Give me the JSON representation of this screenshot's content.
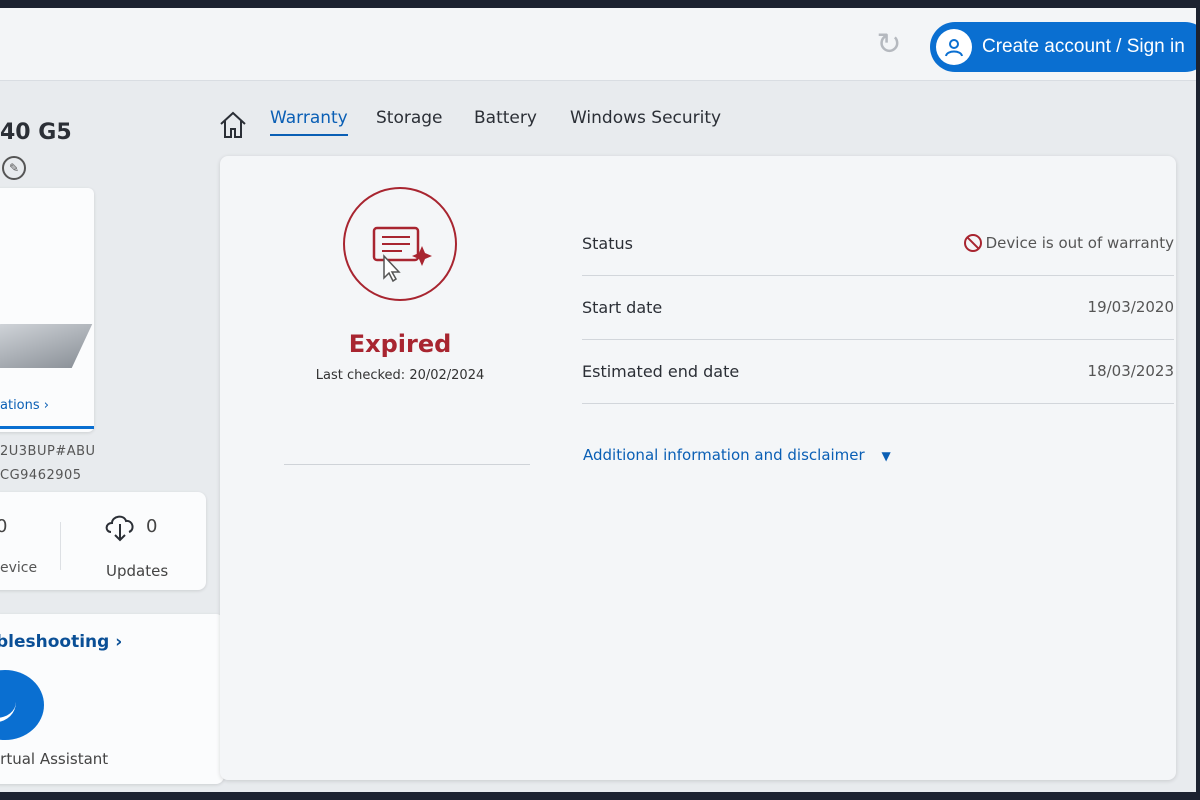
{
  "header": {
    "signin_label": "Create account / Sign in"
  },
  "sidebar": {
    "device_name": "40 G5",
    "card_link": "ations ›",
    "serial_line1": "2U3BUP#ABU",
    "serial_line2": "CG9462905",
    "stats": {
      "device_count": "0",
      "device_label": "evice",
      "updates_count": "0",
      "updates_label": "Updates"
    },
    "troubleshooting": {
      "title": "bleshooting ›",
      "assistant_label": "irtual Assistant"
    }
  },
  "tabs": [
    {
      "label": "Warranty",
      "active": true
    },
    {
      "label": "Storage",
      "active": false
    },
    {
      "label": "Battery",
      "active": false
    },
    {
      "label": "Windows Security",
      "active": false
    }
  ],
  "warranty": {
    "state": "Expired",
    "last_checked": "Last checked: 20/02/2024",
    "accent_color": "#a82530",
    "rows": [
      {
        "key": "Status",
        "value": "Device is out of warranty"
      },
      {
        "key": "Start date",
        "value": "19/03/2020"
      },
      {
        "key": "Estimated end date",
        "value": "18/03/2023"
      }
    ],
    "additional_info": "Additional information and disclaimer"
  }
}
